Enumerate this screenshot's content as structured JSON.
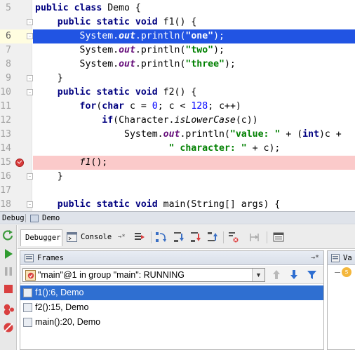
{
  "editor": {
    "lines": [
      {
        "num": "5",
        "parts": [
          [
            "kw",
            "public class "
          ],
          [
            "",
            "Demo {"
          ]
        ]
      },
      {
        "num": "6",
        "parts": [
          [
            "",
            "        System."
          ],
          [
            "fld",
            "out"
          ],
          [
            "",
            ".println("
          ],
          [
            "st",
            "\"one\""
          ],
          [
            "",
            ");"
          ]
        ]
      },
      {
        "num": "7",
        "parts": [
          [
            "",
            "        System."
          ],
          [
            "fld",
            "out"
          ],
          [
            "",
            ".println("
          ],
          [
            "st",
            "\"two\""
          ],
          [
            "",
            ");"
          ]
        ]
      },
      {
        "num": "8",
        "parts": [
          [
            "",
            "        System."
          ],
          [
            "fld",
            "out"
          ],
          [
            "",
            ".println("
          ],
          [
            "st",
            "\"three\""
          ],
          [
            "",
            ");"
          ]
        ]
      },
      {
        "num": "9",
        "parts": [
          [
            "",
            "    }"
          ]
        ]
      },
      {
        "num": "10",
        "parts": [
          [
            "kw",
            "    public static void "
          ],
          [
            "",
            "f2() {"
          ]
        ]
      },
      {
        "num": "11",
        "parts": [
          [
            "kw",
            "        for"
          ],
          [
            "",
            "("
          ],
          [
            "kw",
            "char "
          ],
          [
            "",
            "c = "
          ],
          [
            "num-lit",
            "0"
          ],
          [
            "",
            "; c < "
          ],
          [
            "num-lit",
            "128"
          ],
          [
            "",
            "; c++)"
          ]
        ]
      },
      {
        "num": "12",
        "parts": [
          [
            "kw",
            "            if"
          ],
          [
            "",
            "(Character."
          ],
          [
            "it",
            "isLowerCase"
          ],
          [
            "",
            "(c))"
          ]
        ]
      },
      {
        "num": "13",
        "parts": [
          [
            "",
            "                System."
          ],
          [
            "fld",
            "out"
          ],
          [
            "",
            ".println("
          ],
          [
            "st",
            "\"value: \""
          ],
          [
            "",
            " + ("
          ],
          [
            "kw",
            "int"
          ],
          [
            "",
            ")c +"
          ]
        ]
      },
      {
        "num": "14",
        "parts": [
          [
            "st",
            "                        \" character: \""
          ],
          [
            "",
            " + c);"
          ]
        ]
      },
      {
        "num": "15",
        "parts": [
          [
            "it",
            "        f1"
          ],
          [
            "",
            "();"
          ]
        ]
      },
      {
        "num": "16",
        "parts": [
          [
            "",
            "    }"
          ]
        ]
      },
      {
        "num": "17",
        "parts": [
          [
            "",
            ""
          ]
        ]
      },
      {
        "num": "18",
        "parts": [
          [
            "kw",
            "    public static void "
          ],
          [
            "",
            "main(String[] args) {"
          ]
        ]
      }
    ],
    "line_f1": {
      "num": "",
      "parts": [
        [
          "kw",
          "    public static void "
        ],
        [
          "",
          "f1() {"
        ]
      ]
    }
  },
  "tool": {
    "title": "Debug",
    "config_name": "Demo",
    "tab_debugger": "Debugger",
    "tab_console": "Console",
    "frames_title": "Frames",
    "thread_selected": "\"main\"@1 in group \"main\": RUNNING",
    "frames": [
      "f1():6, Demo",
      "f2():15, Demo",
      "main():20, Demo"
    ],
    "vars_title": "Va"
  },
  "colors": {
    "exec_line": "#2154e3",
    "breakpoint_line": "#fbcaca",
    "selected_frame": "#2f6fd1"
  }
}
